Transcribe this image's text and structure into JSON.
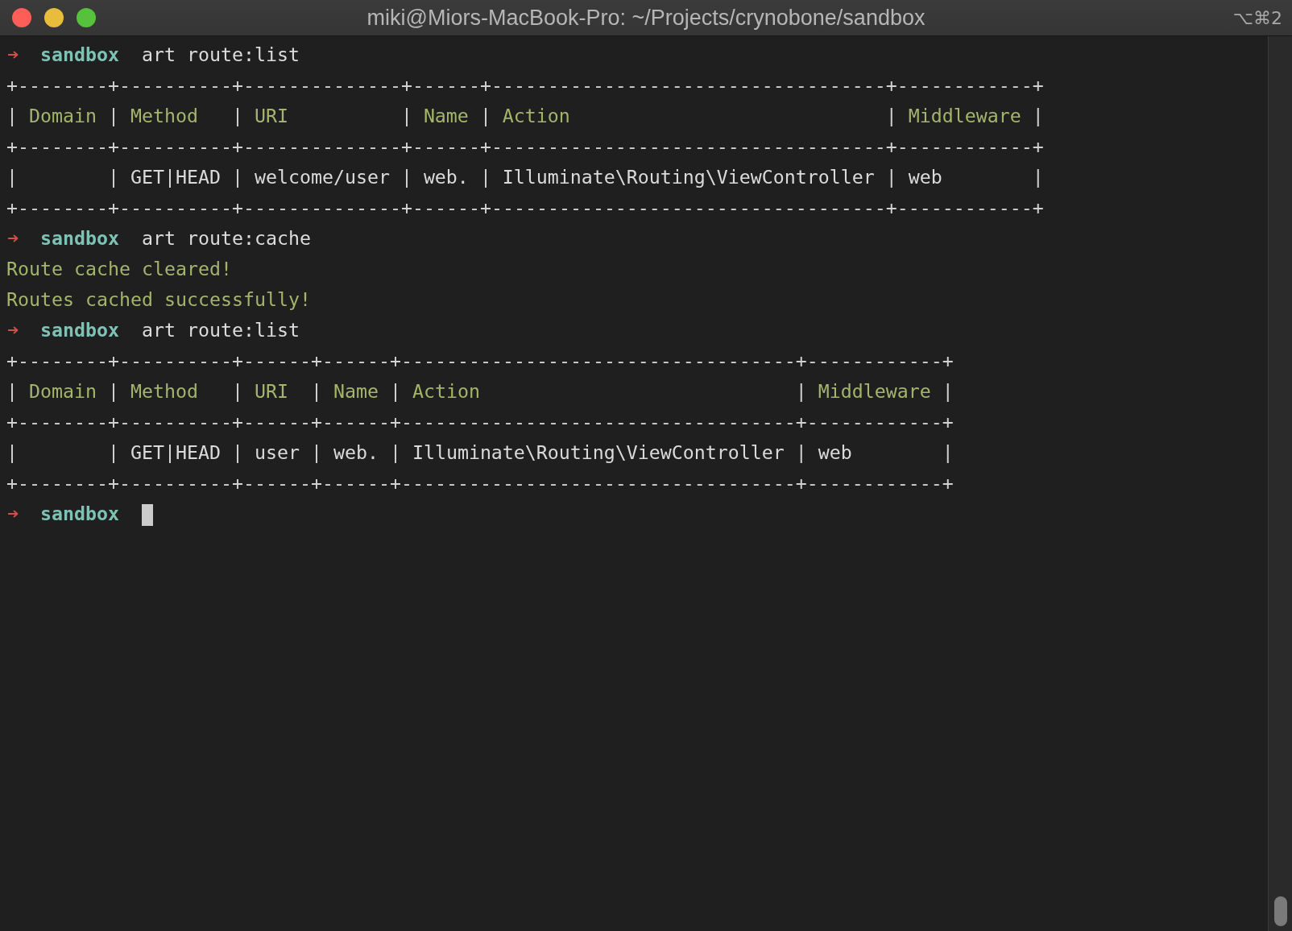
{
  "window": {
    "title": "miki@Miors-MacBook-Pro: ~/Projects/crynobone/sandbox",
    "shortcut": "⌥⌘2"
  },
  "terminal": {
    "lines": [
      {
        "kind": "prompt",
        "directory": "sandbox",
        "command": "art route:list",
        "cursor": false
      },
      {
        "kind": "table",
        "divider": "|",
        "top_rule": "+--------+----------+--------------+------+-----------------------------------+------------+",
        "columns": [
          "Domain",
          "Method",
          "URI",
          "Name",
          "Action",
          "Middleware"
        ],
        "header_rule": "+--------+----------+--------------+------+-----------------------------------+------------+",
        "rows": [
          [
            null,
            "GET|HEAD",
            "welcome/user",
            "web.",
            "Illuminate\\Routing\\ViewController",
            "web"
          ]
        ],
        "bottom_rule": "+--------+----------+--------------+------+-----------------------------------+------------+"
      },
      {
        "kind": "prompt",
        "directory": "sandbox",
        "command": "art route:cache",
        "cursor": false
      },
      {
        "kind": "output",
        "text": "Route cache cleared!"
      },
      {
        "kind": "output",
        "text": "Routes cached successfully!"
      },
      {
        "kind": "prompt",
        "directory": "sandbox",
        "command": "art route:list",
        "cursor": false
      },
      {
        "kind": "table",
        "divider": "|",
        "top_rule": "+--------+----------+------+------+-----------------------------------+------------+",
        "columns": [
          "Domain",
          "Method",
          "URI",
          "Name",
          "Action",
          "Middleware"
        ],
        "header_rule": "+--------+----------+------+------+-----------------------------------+------------+",
        "rows": [
          [
            null,
            "GET|HEAD",
            "user",
            "web.",
            "Illuminate\\Routing\\ViewController",
            "web"
          ]
        ],
        "bottom_rule": "+--------+----------+------+------+-----------------------------------+------------+"
      },
      {
        "kind": "prompt",
        "directory": "sandbox",
        "cursor": true
      }
    ]
  }
}
